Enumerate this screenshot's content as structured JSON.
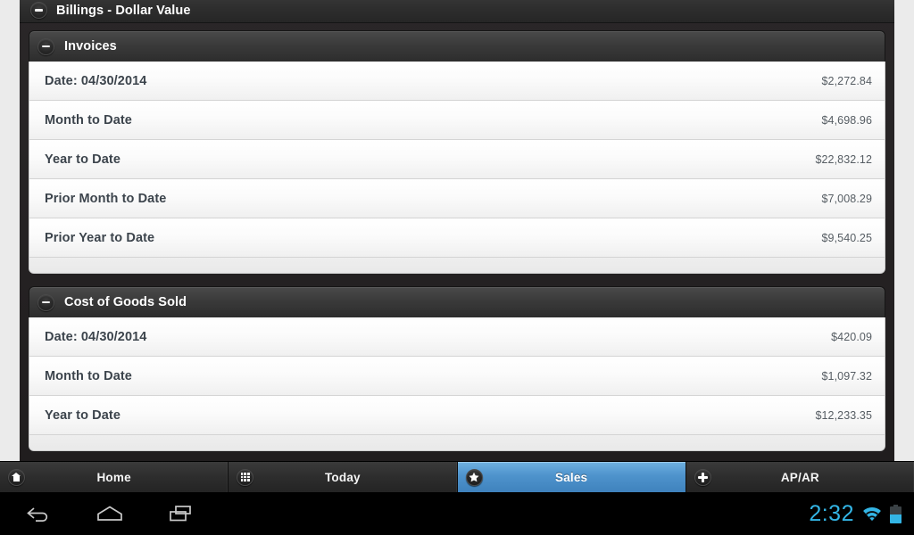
{
  "window": {
    "title": "Billings - Dollar Value",
    "collapse_icon": "minus-circle-icon"
  },
  "panels": [
    {
      "title": "Invoices",
      "collapse_icon": "minus-circle-icon",
      "rows": [
        {
          "label": "Date: 04/30/2014",
          "value": "$2,272.84"
        },
        {
          "label": "Month to Date",
          "value": "$4,698.96"
        },
        {
          "label": "Year to Date",
          "value": "$22,832.12"
        },
        {
          "label": "Prior Month to Date",
          "value": "$7,008.29"
        },
        {
          "label": "Prior Year to Date",
          "value": "$9,540.25"
        }
      ]
    },
    {
      "title": "Cost of Goods Sold",
      "collapse_icon": "minus-circle-icon",
      "rows": [
        {
          "label": "Date: 04/30/2014",
          "value": "$420.09"
        },
        {
          "label": "Month to Date",
          "value": "$1,097.32"
        },
        {
          "label": "Year to Date",
          "value": "$12,233.35"
        }
      ]
    }
  ],
  "tabbar": {
    "tabs": [
      {
        "label": "Home",
        "icon": "home-icon",
        "active": false
      },
      {
        "label": "Today",
        "icon": "grid-icon",
        "active": false
      },
      {
        "label": "Sales",
        "icon": "star-icon",
        "active": true
      },
      {
        "label": "AP/AR",
        "icon": "plus-icon",
        "active": false
      }
    ],
    "active_color": "#4e93cc"
  },
  "system_bar": {
    "back_icon": "back-arrow-icon",
    "home_icon": "home-pentagon-icon",
    "recents_icon": "recent-apps-icon",
    "clock": "2:32",
    "wifi_icon": "wifi-icon",
    "battery_icon": "battery-icon",
    "accent_color": "#33b5e5"
  }
}
